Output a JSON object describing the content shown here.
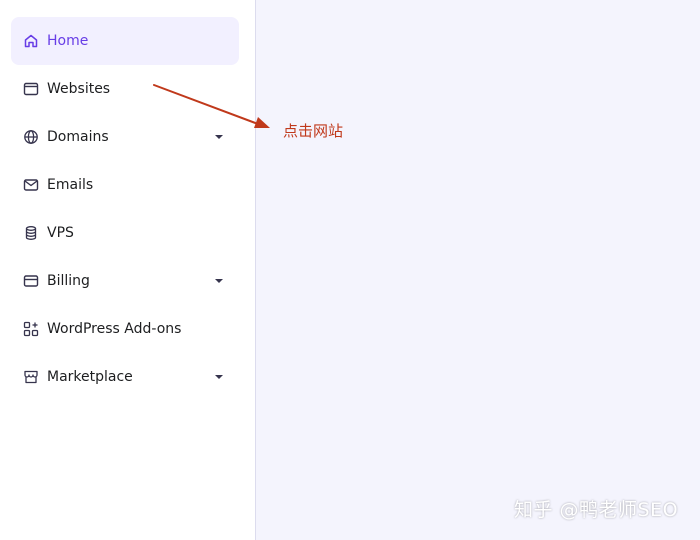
{
  "sidebar": {
    "items": [
      {
        "label": "Home",
        "icon": "home-icon",
        "active": true
      },
      {
        "label": "Websites",
        "icon": "browser-window-icon"
      },
      {
        "label": "Domains",
        "icon": "globe-icon",
        "has_dropdown": true
      },
      {
        "label": "Emails",
        "icon": "mail-icon"
      },
      {
        "label": "VPS",
        "icon": "database-icon"
      },
      {
        "label": "Billing",
        "icon": "credit-card-icon",
        "has_dropdown": true
      },
      {
        "label": "WordPress Add-ons",
        "icon": "add-ons-grid-icon"
      },
      {
        "label": "Marketplace",
        "icon": "store-icon",
        "has_dropdown": true
      }
    ]
  },
  "annotation": {
    "text": "点击网站",
    "color": "#c0391b"
  },
  "watermark": {
    "text": "知乎 @鸭老师SEO"
  },
  "colors": {
    "accent": "#673de6",
    "active_bg": "#f2f0ff",
    "main_bg": "#f4f4fd",
    "text": "#1d1e20"
  }
}
